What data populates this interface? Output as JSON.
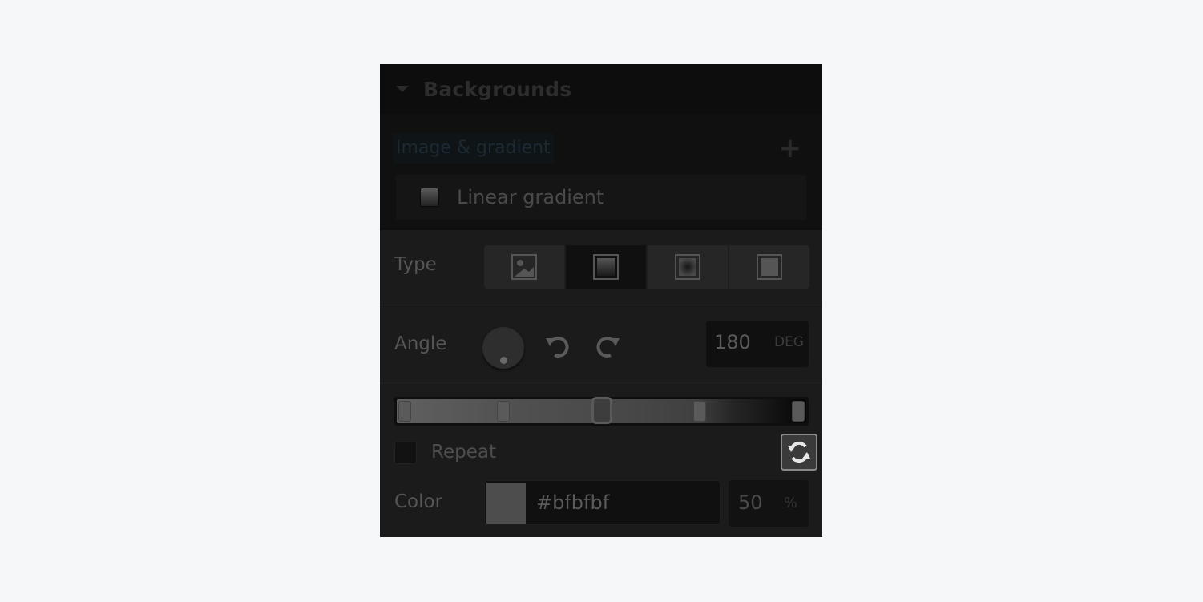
{
  "section": {
    "title": "Backgrounds",
    "collapse_icon": "caret-down-icon"
  },
  "layers": {
    "tag_label": "Image & gradient",
    "add_icon": "plus-icon",
    "items": [
      {
        "label": "Linear gradient"
      }
    ]
  },
  "gradient_editor": {
    "type": {
      "label": "Type",
      "options": [
        {
          "name": "image",
          "icon": "image-icon",
          "active": false
        },
        {
          "name": "linear-gradient",
          "icon": "linear-gradient-icon",
          "active": true
        },
        {
          "name": "radial-gradient",
          "icon": "radial-gradient-icon",
          "active": false
        },
        {
          "name": "color-overlay",
          "icon": "color-overlay-icon",
          "active": false
        }
      ]
    },
    "angle": {
      "label": "Angle",
      "value": "180",
      "unit": "DEG",
      "rotate_left_icon": "rotate-ccw-icon",
      "rotate_right_icon": "rotate-cw-icon"
    },
    "stops": [
      {
        "position_pct": 0,
        "selected": false
      },
      {
        "position_pct": 25,
        "selected": false
      },
      {
        "position_pct": 50,
        "selected": true
      },
      {
        "position_pct": 75,
        "selected": false
      },
      {
        "position_pct": 100,
        "selected": false
      }
    ],
    "repeat": {
      "label": "Repeat",
      "checked": false,
      "reverse_icon": "reverse-gradient-icon"
    },
    "color": {
      "label": "Color",
      "hex": "#bfbfbf",
      "opacity": "50",
      "opacity_unit": "%"
    }
  }
}
